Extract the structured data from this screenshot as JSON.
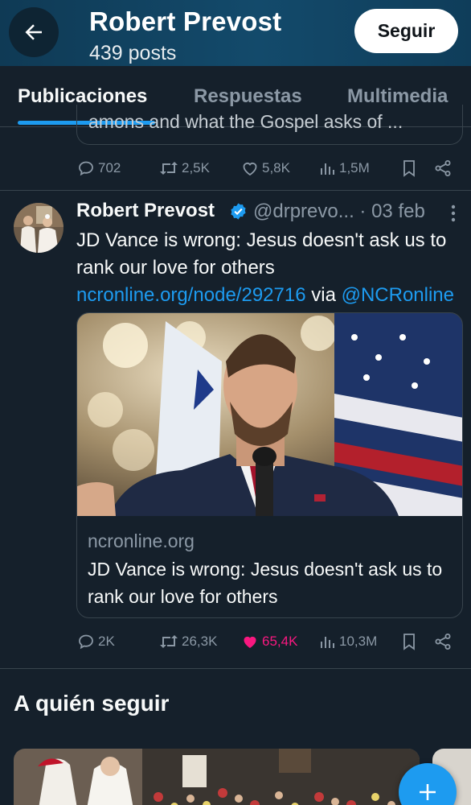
{
  "header": {
    "title": "Robert Prevost",
    "subtitle": "439 posts",
    "follow_label": "Seguir",
    "back_icon": "arrow-left-icon"
  },
  "tabs": [
    {
      "label": "Publicaciones",
      "active": true
    },
    {
      "label": "Respuestas",
      "active": false
    },
    {
      "label": "Multimedia",
      "active": false
    }
  ],
  "previous_post": {
    "card_text": "amons  and what the Gospel asks of ...",
    "actions": {
      "replies": "702",
      "reposts": "2,5K",
      "likes": "5,8K",
      "views": "1,5M"
    }
  },
  "tweet": {
    "author": "Robert Prevost",
    "handle": "@drprevo...",
    "date": "· 03 feb",
    "text_plain": "JD Vance is wrong: Jesus doesn't ask us to rank our love for others ",
    "link1": "ncronline.org/node/292716",
    "text_via": " via ",
    "mention": "@NCRonline",
    "card": {
      "domain": "ncronline.org",
      "title": "JD Vance is wrong: Jesus doesn't ask us to rank our love for others"
    },
    "actions": {
      "replies": "2K",
      "reposts": "26,3K",
      "likes": "65,4K",
      "views": "10,3M",
      "liked": true
    }
  },
  "who_to_follow": {
    "title": "A quién seguir"
  },
  "colors": {
    "accent": "#1d9bf0",
    "like": "#f91880",
    "background": "#15202b"
  }
}
